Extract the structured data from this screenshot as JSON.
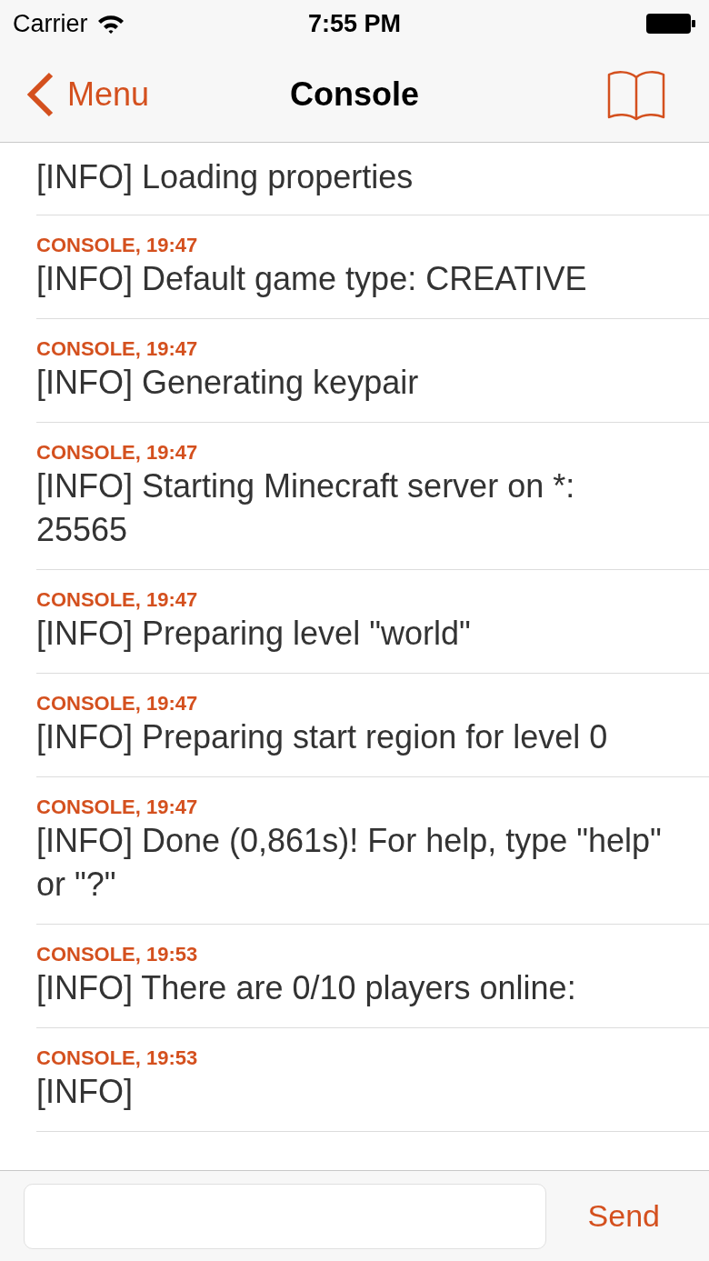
{
  "status_bar": {
    "carrier": "Carrier",
    "time": "7:55 PM"
  },
  "nav": {
    "back_label": "Menu",
    "title": "Console"
  },
  "log": [
    {
      "message": "[INFO] Loading properties"
    },
    {
      "header": "CONSOLE, 19:47",
      "message": "[INFO] Default game type: CREATIVE"
    },
    {
      "header": "CONSOLE, 19:47",
      "message": "[INFO] Generating keypair"
    },
    {
      "header": "CONSOLE, 19:47",
      "message": "[INFO] Starting Minecraft server on *: 25565"
    },
    {
      "header": "CONSOLE, 19:47",
      "message": "[INFO] Preparing level \"world\""
    },
    {
      "header": "CONSOLE, 19:47",
      "message": "[INFO] Preparing start region for level 0"
    },
    {
      "header": "CONSOLE, 19:47",
      "message": "[INFO] Done (0,861s)! For help, type \"help\" or \"?\""
    },
    {
      "header": "CONSOLE, 19:53",
      "message": "[INFO] There are 0/10 players online:"
    },
    {
      "header": "CONSOLE, 19:53",
      "message": "[INFO]"
    }
  ],
  "composer": {
    "send_label": "Send"
  }
}
